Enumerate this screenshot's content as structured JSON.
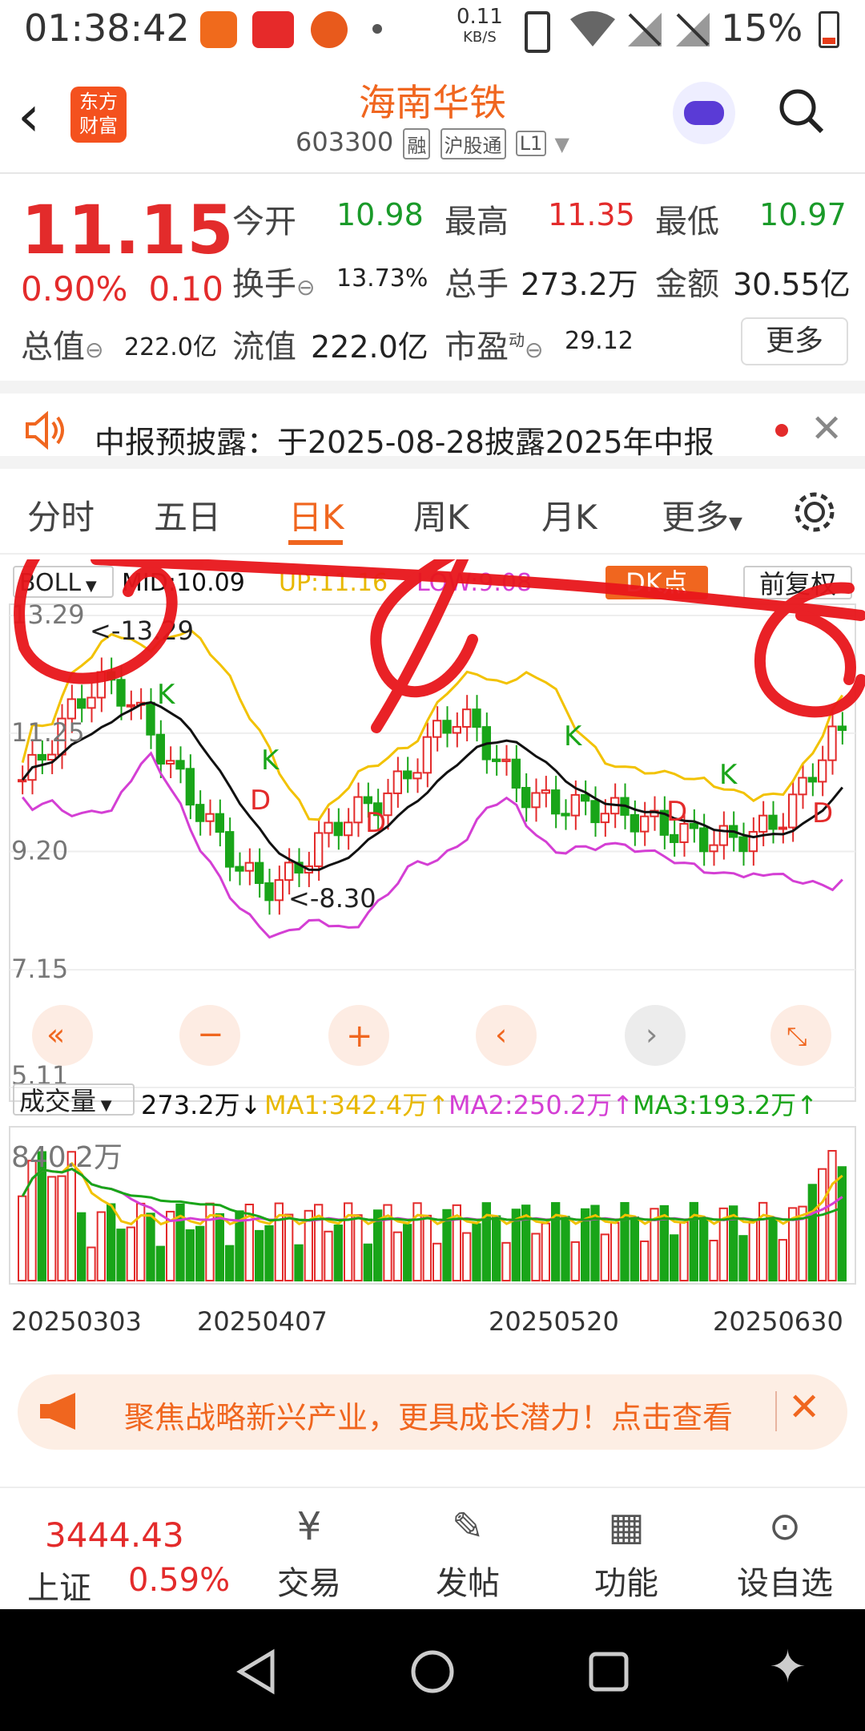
{
  "status_bar": {
    "time": "01:38:42",
    "net_speed": "0.11",
    "net_unit": "KB/S",
    "battery": "15%"
  },
  "header": {
    "stock_name": "海南华铁",
    "code": "603300",
    "tags": [
      "融",
      "沪股通",
      "L1"
    ],
    "logo_line1": "东方",
    "logo_line2": "财富"
  },
  "quote": {
    "price": "11.15",
    "change_pct": "0.90%",
    "change": "0.10",
    "open_label": "今开",
    "open": "10.98",
    "high_label": "最高",
    "high": "11.35",
    "low_label": "最低",
    "low": "10.97",
    "turnover_label": "换手",
    "turnover": "13.73%",
    "volume_label": "总手",
    "volume": "273.2万",
    "amount_label": "金额",
    "amount": "30.55亿",
    "mktcap_label": "总值",
    "mktcap": "222.0亿",
    "float_label": "流值",
    "float": "222.0亿",
    "pe_label": "市盈",
    "pe_sup": "动",
    "pe": "29.12",
    "more": "更多"
  },
  "notice": {
    "text": "中报预披露：于2025-08-28披露2025年中报"
  },
  "tabs": [
    "分时",
    "五日",
    "日K",
    "周K",
    "月K",
    "更多"
  ],
  "indicator": {
    "name": "BOLL",
    "mid": "MID:10.09",
    "up": "UP:11.16",
    "low": "LOW:9.08",
    "dk": "DK点",
    "adjust": "前复权"
  },
  "volume_indicator": {
    "name": "成交量",
    "value": "273.2万",
    "ma1": "MA1:342.4万",
    "ma2": "MA2:250.2万",
    "ma3": "MA3:193.2万",
    "max": "840.2万"
  },
  "chart_data": {
    "type": "candlestick",
    "y_ticks": [
      "13.29",
      "11.25",
      "9.20",
      "7.15",
      "5.11"
    ],
    "ylim": [
      5.11,
      13.29
    ],
    "x_ticks": [
      "20250303",
      "20250407",
      "20250520",
      "20250630"
    ],
    "annotations": [
      "<-13.29",
      "<-8.30",
      "K",
      "D"
    ],
    "colors": {
      "up": "#e32b2b",
      "down": "#19a519",
      "mid": "#111111",
      "upper": "#f2c200",
      "lower": "#d43fd4"
    }
  },
  "banner": {
    "text": "聚焦战略新兴产业，更具成长潜力！点击查看"
  },
  "bottom_bar": {
    "index_value": "3444.43",
    "index_name": "上证",
    "index_pct": "0.59%",
    "items": [
      {
        "label": "交易",
        "icon": "yen-icon"
      },
      {
        "label": "发帖",
        "icon": "edit-icon"
      },
      {
        "label": "功能",
        "icon": "grid-icon"
      },
      {
        "label": "设自选",
        "icon": "more-circle-icon"
      }
    ]
  }
}
